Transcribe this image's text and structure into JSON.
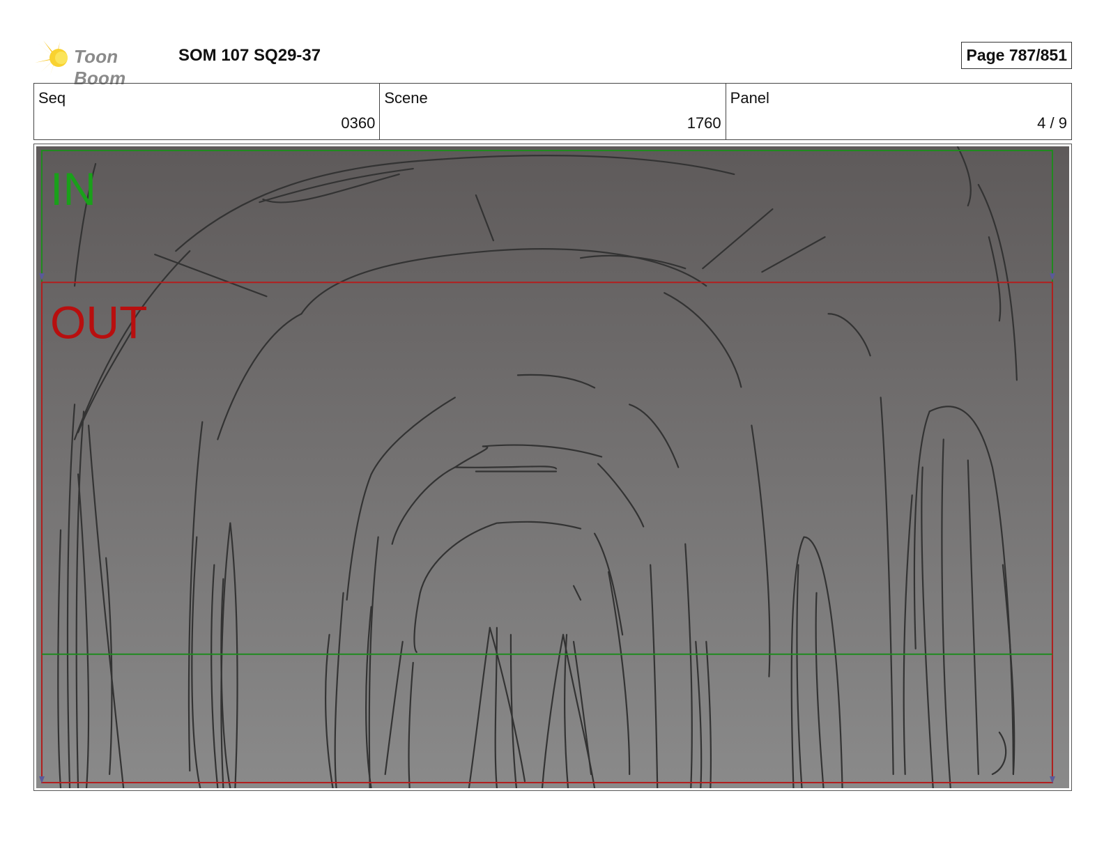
{
  "header": {
    "logo_text": "Toon Boom",
    "project_title": "SOM 107 SQ29-37",
    "page_indicator": "Page 787/851"
  },
  "info": {
    "seq_label": "Seq",
    "seq_value": "0360",
    "scene_label": "Scene",
    "scene_value": "1760",
    "panel_label": "Panel",
    "panel_value": "4 / 9"
  },
  "panel": {
    "in_label": "IN",
    "out_label": "OUT",
    "colors": {
      "in_frame": "#1f8a1f",
      "out_frame": "#b21f1f",
      "sketch_stroke": "#333333",
      "bg_top": "#5e5a5a",
      "bg_bottom": "#8a8a8a"
    }
  }
}
